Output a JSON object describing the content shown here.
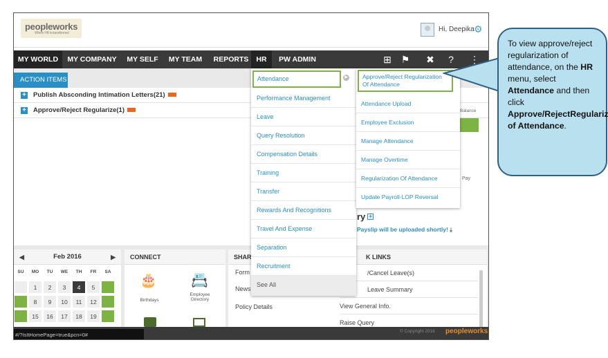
{
  "header": {
    "logo_main": "peopleworks",
    "logo_tagline": "Where HR is transformed",
    "greeting": "Hi, Deepika"
  },
  "nav": {
    "items": [
      "MY WORLD",
      "MY COMPANY",
      "MY SELF",
      "MY TEAM",
      "REPORTS",
      "HR",
      "PW ADMIN"
    ],
    "icons": [
      "book-icon",
      "flag-icon",
      "tools-icon",
      "help-icon",
      "menu-icon"
    ]
  },
  "actions": {
    "tab": "ACTION ITEMS",
    "rows": [
      "Publish Absconding Intimation Letters(21)",
      "Approve/Reject Regularize(1)"
    ]
  },
  "right": {
    "balance": "Balance",
    "pay": "Pay",
    "payslip_title": "ry",
    "payslip_note": "Payslip will be uploaded shortly!"
  },
  "calendar": {
    "month": "Feb 2016",
    "dow": [
      "SU",
      "MO",
      "TU",
      "WE",
      "TH",
      "FR",
      "SA"
    ],
    "week1": [
      "",
      "1",
      "2",
      "3",
      "4",
      "5",
      ""
    ],
    "week2": [
      "",
      "8",
      "9",
      "10",
      "11",
      "12",
      ""
    ],
    "week3": [
      "",
      "15",
      "16",
      "17",
      "18",
      "19",
      ""
    ]
  },
  "connect": {
    "title": "CONNECT",
    "birthdays": "Birthdays",
    "directory_line1": "Employee",
    "directory_line2": "Directory"
  },
  "share": {
    "title": "SHAR",
    "links": [
      "Form",
      "News",
      "Policy Details"
    ]
  },
  "quick": {
    "title": "K LINKS",
    "links": [
      "/Cancel Leave(s)",
      "Leave Summary",
      "View General Info.",
      "Raise Query"
    ]
  },
  "footer": {
    "status_url": "#/?IsItHomePage=true&pcn=0#",
    "copyright": "© Copyright 2016",
    "logo": "peopleworks"
  },
  "menu_hr": [
    "Attendance",
    "Performance Management",
    "Leave",
    "Query Resolution",
    "Compensation Details",
    "Training",
    "Transfer",
    "Rewards And Recognitions",
    "Travel And Expense",
    "Separation",
    "Recruitment",
    "See All"
  ],
  "menu_attendance": [
    "Approve/Reject Regularization Of Attendance",
    "Attendance Upload",
    "Employee Exclusion",
    "Manage Attendance",
    "Manage Overtime",
    "Regularization Of Attendance",
    "Update Payroll-LOP Reversal"
  ],
  "callout": {
    "line1": "To view approve/reject regularization of attendance, on the ",
    "hr": "HR",
    "line2": " menu, select ",
    "attendance": "Attendance",
    "line3": " and then click ",
    "target": "Approve/RejectRegularization of Attendance",
    "end": "."
  },
  "colors": {
    "accent": "#2a8fc4",
    "green": "#7cb342",
    "nav_bg": "#3a3a3a",
    "callout_bg": "#b9e0ef"
  }
}
